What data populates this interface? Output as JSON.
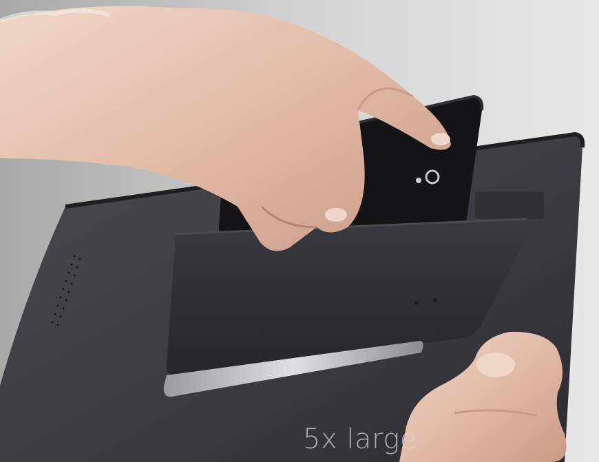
{
  "scene": {
    "caption": "5x large",
    "colors": {
      "background": "#c9c9c9",
      "tablet_body": "#3b3a40",
      "tablet_edge": "#1f1e23",
      "station_dock": "#2c2b31",
      "phone": "#141417",
      "silver_trim": "#b8b8bc",
      "skin": "#e7c3b0",
      "skin_shadow": "#c99a86"
    },
    "objects": [
      "hand-inserting-phone",
      "tablet-back",
      "phone-dock-slot",
      "holding-hand"
    ]
  }
}
